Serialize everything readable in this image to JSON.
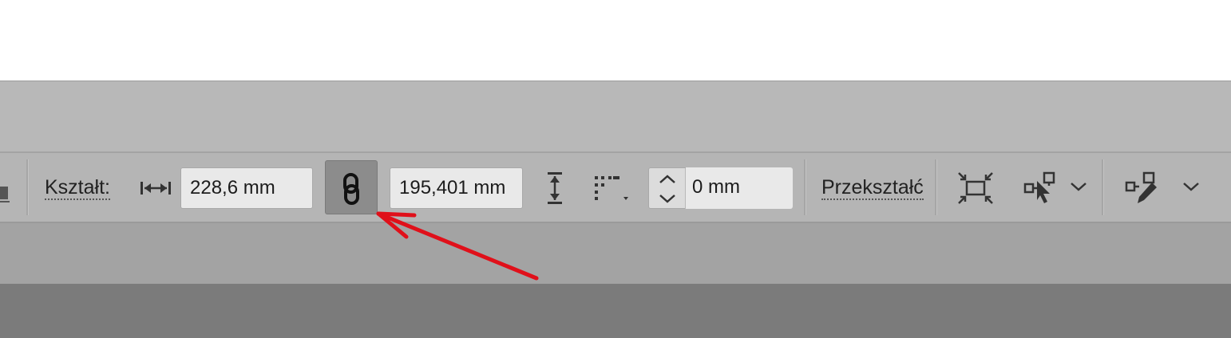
{
  "toolbar": {
    "shape_label": "Kształt:",
    "width_value": "228,6 mm",
    "height_value": "195,401 mm",
    "corner_value": "0 mm",
    "transform_label": "Przekształć"
  },
  "icons": {
    "left_partial": "partial-tool-icon",
    "width": "width-arrows-icon",
    "link": "chain-link-icon",
    "height": "height-arrows-icon",
    "corner_options": "corner-options-icon",
    "stepper": "stepper-arrows-icon",
    "align_center": "align-to-center-icon",
    "select_transform": "select-transform-icon",
    "edit_shape": "edit-shape-icon",
    "chevron": "chevron-down-icon",
    "annotation_arrow": "red-arrow"
  },
  "colors": {
    "bar": "#b5b5b5",
    "field": "#e9e9e9",
    "active_button": "#8c8c8c",
    "annotation": "#e0101a"
  }
}
